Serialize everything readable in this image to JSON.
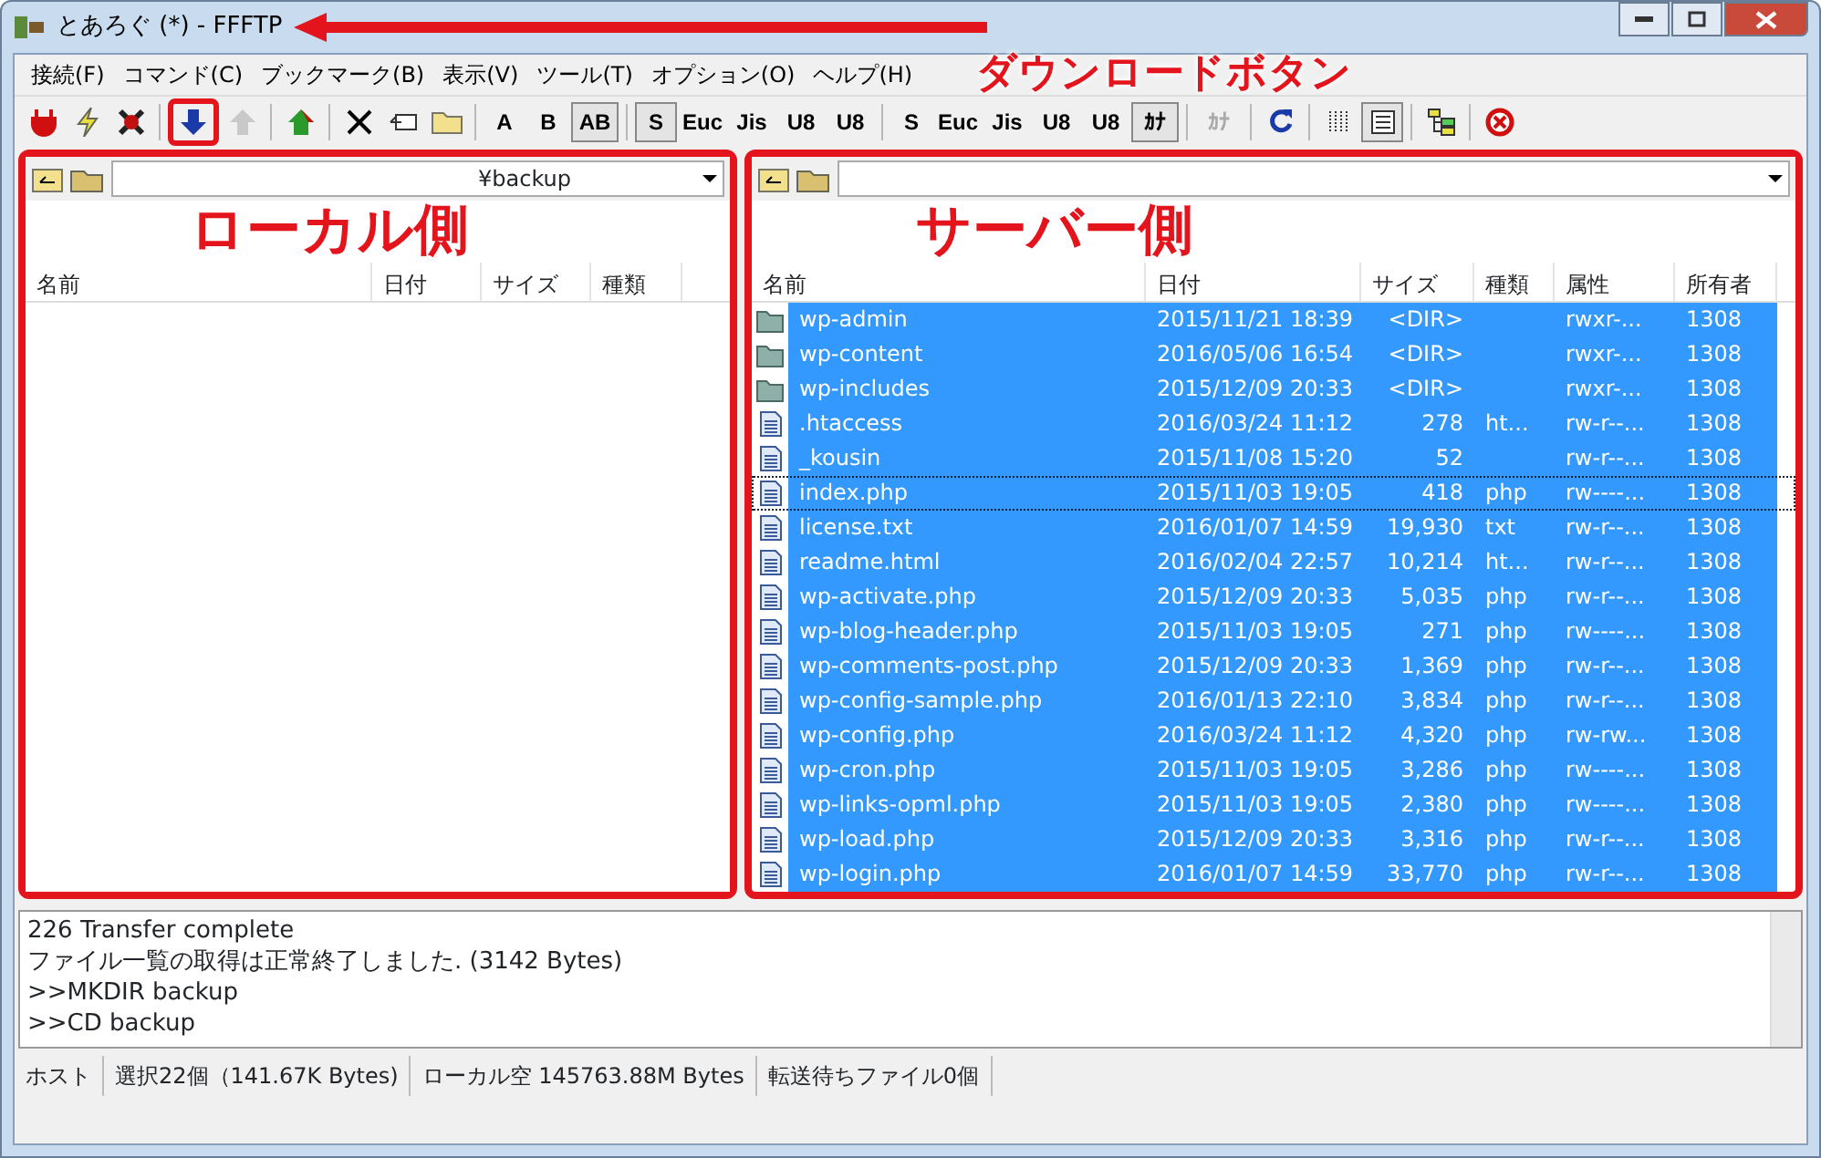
{
  "window": {
    "title": "とあろぐ (*) - FFFTP"
  },
  "menu": [
    {
      "label": "接続(F)"
    },
    {
      "label": "コマンド(C)"
    },
    {
      "label": "ブックマーク(B)"
    },
    {
      "label": "表示(V)"
    },
    {
      "label": "ツール(T)"
    },
    {
      "label": "オプション(O)"
    },
    {
      "label": "ヘルプ(H)"
    }
  ],
  "callout": {
    "text": "ダウンロードボタン"
  },
  "toolbar": [
    {
      "kind": "plug",
      "disabled": false,
      "pressed": false,
      "highlighted": false
    },
    {
      "kind": "bolt",
      "disabled": false,
      "pressed": false,
      "highlighted": false
    },
    {
      "kind": "unplug",
      "disabled": false,
      "pressed": false,
      "highlighted": false
    },
    {
      "kind": "sep"
    },
    {
      "kind": "down",
      "disabled": false,
      "pressed": false,
      "highlighted": true
    },
    {
      "kind": "up",
      "disabled": true,
      "pressed": false,
      "highlighted": false
    },
    {
      "kind": "sep"
    },
    {
      "kind": "house",
      "disabled": false,
      "pressed": false,
      "highlighted": false
    },
    {
      "kind": "sep"
    },
    {
      "kind": "delete",
      "disabled": false,
      "pressed": false,
      "highlighted": false
    },
    {
      "kind": "rename",
      "disabled": false,
      "pressed": false,
      "highlighted": false
    },
    {
      "kind": "folder",
      "disabled": false,
      "pressed": false,
      "highlighted": false
    },
    {
      "kind": "sep"
    },
    {
      "kind": "text",
      "label": "A",
      "disabled": false,
      "pressed": false,
      "highlighted": false
    },
    {
      "kind": "text",
      "label": "B",
      "disabled": false,
      "pressed": false,
      "highlighted": false
    },
    {
      "kind": "text",
      "label": "AB",
      "disabled": false,
      "pressed": true,
      "highlighted": false
    },
    {
      "kind": "sep"
    },
    {
      "kind": "text",
      "label": "S",
      "disabled": false,
      "pressed": true,
      "highlighted": false
    },
    {
      "kind": "text",
      "label": "Euc",
      "disabled": false,
      "pressed": false,
      "highlighted": false
    },
    {
      "kind": "text",
      "label": "Jis",
      "disabled": false,
      "pressed": false,
      "highlighted": false
    },
    {
      "kind": "text",
      "label": "U8",
      "disabled": false,
      "pressed": false,
      "highlighted": false
    },
    {
      "kind": "text",
      "label": "U8",
      "disabled": false,
      "pressed": false,
      "highlighted": false
    },
    {
      "kind": "sep"
    },
    {
      "kind": "text",
      "label": "S",
      "disabled": false,
      "pressed": false,
      "highlighted": false
    },
    {
      "kind": "text",
      "label": "Euc",
      "disabled": false,
      "pressed": false,
      "highlighted": false
    },
    {
      "kind": "text",
      "label": "Jis",
      "disabled": false,
      "pressed": false,
      "highlighted": false
    },
    {
      "kind": "text",
      "label": "U8",
      "disabled": false,
      "pressed": false,
      "highlighted": false
    },
    {
      "kind": "text",
      "label": "U8",
      "disabled": false,
      "pressed": false,
      "highlighted": false
    },
    {
      "kind": "text",
      "label": "ｶﾅ",
      "disabled": false,
      "pressed": true,
      "highlighted": false
    },
    {
      "kind": "sep"
    },
    {
      "kind": "text",
      "label": "ｶﾅ",
      "disabled": true,
      "pressed": false,
      "highlighted": false
    },
    {
      "kind": "sep"
    },
    {
      "kind": "refresh",
      "disabled": false,
      "pressed": false,
      "highlighted": false
    },
    {
      "kind": "sep"
    },
    {
      "kind": "list",
      "disabled": false,
      "pressed": false,
      "highlighted": false
    },
    {
      "kind": "details",
      "disabled": false,
      "pressed": true,
      "highlighted": false
    },
    {
      "kind": "sep"
    },
    {
      "kind": "tree",
      "disabled": false,
      "pressed": false,
      "highlighted": false
    },
    {
      "kind": "sep"
    },
    {
      "kind": "stop",
      "disabled": false,
      "pressed": false,
      "highlighted": false
    }
  ],
  "local": {
    "label": "ローカル側",
    "path": "¥backup",
    "columns": [
      "名前",
      "日付",
      "サイズ",
      "種類"
    ]
  },
  "server": {
    "label": "サーバー側",
    "columns": [
      "名前",
      "日付",
      "サイズ",
      "種類",
      "属性",
      "所有者"
    ],
    "rows": [
      {
        "kind": "folder",
        "selected": true,
        "focused": false,
        "cells": [
          "wp-admin",
          "2015/11/21 18:39",
          "<DIR>",
          "",
          "rwxr-...",
          "1308"
        ]
      },
      {
        "kind": "folder",
        "selected": true,
        "focused": false,
        "cells": [
          "wp-content",
          "2016/05/06 16:54",
          "<DIR>",
          "",
          "rwxr-...",
          "1308"
        ]
      },
      {
        "kind": "folder",
        "selected": true,
        "focused": false,
        "cells": [
          "wp-includes",
          "2015/12/09 20:33",
          "<DIR>",
          "",
          "rwxr-...",
          "1308"
        ]
      },
      {
        "kind": "file",
        "selected": true,
        "focused": false,
        "cells": [
          ".htaccess",
          "2016/03/24 11:12",
          "278",
          "ht...",
          "rw-r--...",
          "1308"
        ]
      },
      {
        "kind": "file",
        "selected": true,
        "focused": false,
        "cells": [
          "_kousin",
          "2015/11/08 15:20",
          "52",
          "",
          "rw-r--...",
          "1308"
        ]
      },
      {
        "kind": "file",
        "selected": true,
        "focused": true,
        "cells": [
          "index.php",
          "2015/11/03 19:05",
          "418",
          "php",
          "rw----...",
          "1308"
        ]
      },
      {
        "kind": "file",
        "selected": true,
        "focused": false,
        "cells": [
          "license.txt",
          "2016/01/07 14:59",
          "19,930",
          "txt",
          "rw-r--...",
          "1308"
        ]
      },
      {
        "kind": "file",
        "selected": true,
        "focused": false,
        "cells": [
          "readme.html",
          "2016/02/04 22:57",
          "10,214",
          "ht...",
          "rw-r--...",
          "1308"
        ]
      },
      {
        "kind": "file",
        "selected": true,
        "focused": false,
        "cells": [
          "wp-activate.php",
          "2015/12/09 20:33",
          "5,035",
          "php",
          "rw-r--...",
          "1308"
        ]
      },
      {
        "kind": "file",
        "selected": true,
        "focused": false,
        "cells": [
          "wp-blog-header.php",
          "2015/11/03 19:05",
          "271",
          "php",
          "rw----...",
          "1308"
        ]
      },
      {
        "kind": "file",
        "selected": true,
        "focused": false,
        "cells": [
          "wp-comments-post.php",
          "2015/12/09 20:33",
          "1,369",
          "php",
          "rw-r--...",
          "1308"
        ]
      },
      {
        "kind": "file",
        "selected": true,
        "focused": false,
        "cells": [
          "wp-config-sample.php",
          "2016/01/13 22:10",
          "3,834",
          "php",
          "rw-r--...",
          "1308"
        ]
      },
      {
        "kind": "file",
        "selected": true,
        "focused": false,
        "cells": [
          "wp-config.php",
          "2016/03/24 11:12",
          "4,320",
          "php",
          "rw-rw...",
          "1308"
        ]
      },
      {
        "kind": "file",
        "selected": true,
        "focused": false,
        "cells": [
          "wp-cron.php",
          "2015/11/03 19:05",
          "3,286",
          "php",
          "rw----...",
          "1308"
        ]
      },
      {
        "kind": "file",
        "selected": true,
        "focused": false,
        "cells": [
          "wp-links-opml.php",
          "2015/11/03 19:05",
          "2,380",
          "php",
          "rw----...",
          "1308"
        ]
      },
      {
        "kind": "file",
        "selected": true,
        "focused": false,
        "cells": [
          "wp-load.php",
          "2015/12/09 20:33",
          "3,316",
          "php",
          "rw-r--...",
          "1308"
        ]
      },
      {
        "kind": "file",
        "selected": true,
        "focused": false,
        "cells": [
          "wp-login.php",
          "2016/01/07 14:59",
          "33,770",
          "php",
          "rw-r--...",
          "1308"
        ]
      }
    ]
  },
  "log": [
    "226 Transfer complete",
    "ファイル一覧の取得は正常終了しました. (3142 Bytes)",
    ">>MKDIR backup",
    ">>CD backup"
  ],
  "status_bar": [
    "ホスト",
    "選択22個（141.67K Bytes)",
    "ローカル空 145763.88M Bytes",
    "転送待ちファイル0個"
  ]
}
